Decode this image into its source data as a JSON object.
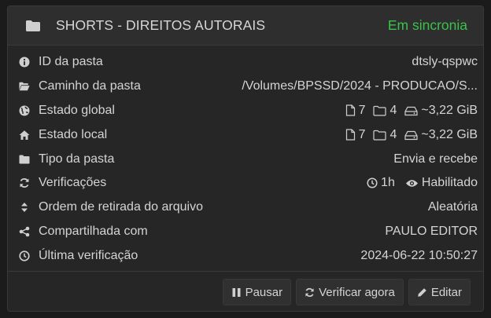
{
  "header": {
    "title": "SHORTS - DIREITOS AUTORAIS",
    "status": "Em sincronia",
    "status_color": "#3cc14d",
    "icon": "folder-icon"
  },
  "rows": [
    {
      "key": "id",
      "label": "ID da pasta",
      "icon": "info-icon",
      "value": "dtsly-qspwc"
    },
    {
      "key": "path",
      "label": "Caminho da pasta",
      "icon": "folder-open-icon",
      "value": "/Volumes/BPSSD/2024 - PRODUCAO/S..."
    },
    {
      "key": "global",
      "label": "Estado global",
      "icon": "globe-icon",
      "files": "7",
      "dirs": "4",
      "size": "~3,22 GiB"
    },
    {
      "key": "local",
      "label": "Estado local",
      "icon": "home-icon",
      "files": "7",
      "dirs": "4",
      "size": "~3,22 GiB"
    },
    {
      "key": "type",
      "label": "Tipo da pasta",
      "icon": "folder-icon",
      "value": "Envia e recebe"
    },
    {
      "key": "rescan",
      "label": "Verificações",
      "icon": "refresh-icon",
      "interval": "1h",
      "watch": "Habilitado"
    },
    {
      "key": "order",
      "label": "Ordem de retirada do arquivo",
      "icon": "sort-icon",
      "value": "Aleatória"
    },
    {
      "key": "shared",
      "label": "Compartilhada com",
      "icon": "share-icon",
      "value": "PAULO EDITOR"
    },
    {
      "key": "last",
      "label": "Última verificação",
      "icon": "clock-icon",
      "value": "2024-06-22 10:50:27"
    }
  ],
  "buttons": {
    "pause": "Pausar",
    "rescan": "Verificar agora",
    "edit": "Editar"
  }
}
